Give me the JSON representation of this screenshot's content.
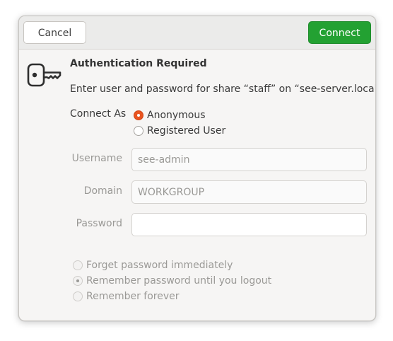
{
  "header": {
    "cancel_label": "Cancel",
    "connect_label": "Connect"
  },
  "icon": "key-icon",
  "title": "Authentication Required",
  "message": "Enter user and password for share “staff” on “see-server.local”:",
  "connect_as": {
    "label": "Connect As",
    "options": [
      {
        "label": "Anonymous",
        "selected": true
      },
      {
        "label": "Registered User",
        "selected": false
      }
    ]
  },
  "fields": {
    "username": {
      "label": "Username",
      "value": "see-admin"
    },
    "domain": {
      "label": "Domain",
      "value": "WORKGROUP"
    },
    "password": {
      "label": "Password",
      "value": ""
    }
  },
  "remember": {
    "options": [
      {
        "label": "Forget password immediately",
        "selected": false
      },
      {
        "label": "Remember password until you logout",
        "selected": true
      },
      {
        "label": "Remember forever",
        "selected": false
      }
    ]
  },
  "colors": {
    "accent": "#e95420",
    "connect_button": "#23a132"
  }
}
